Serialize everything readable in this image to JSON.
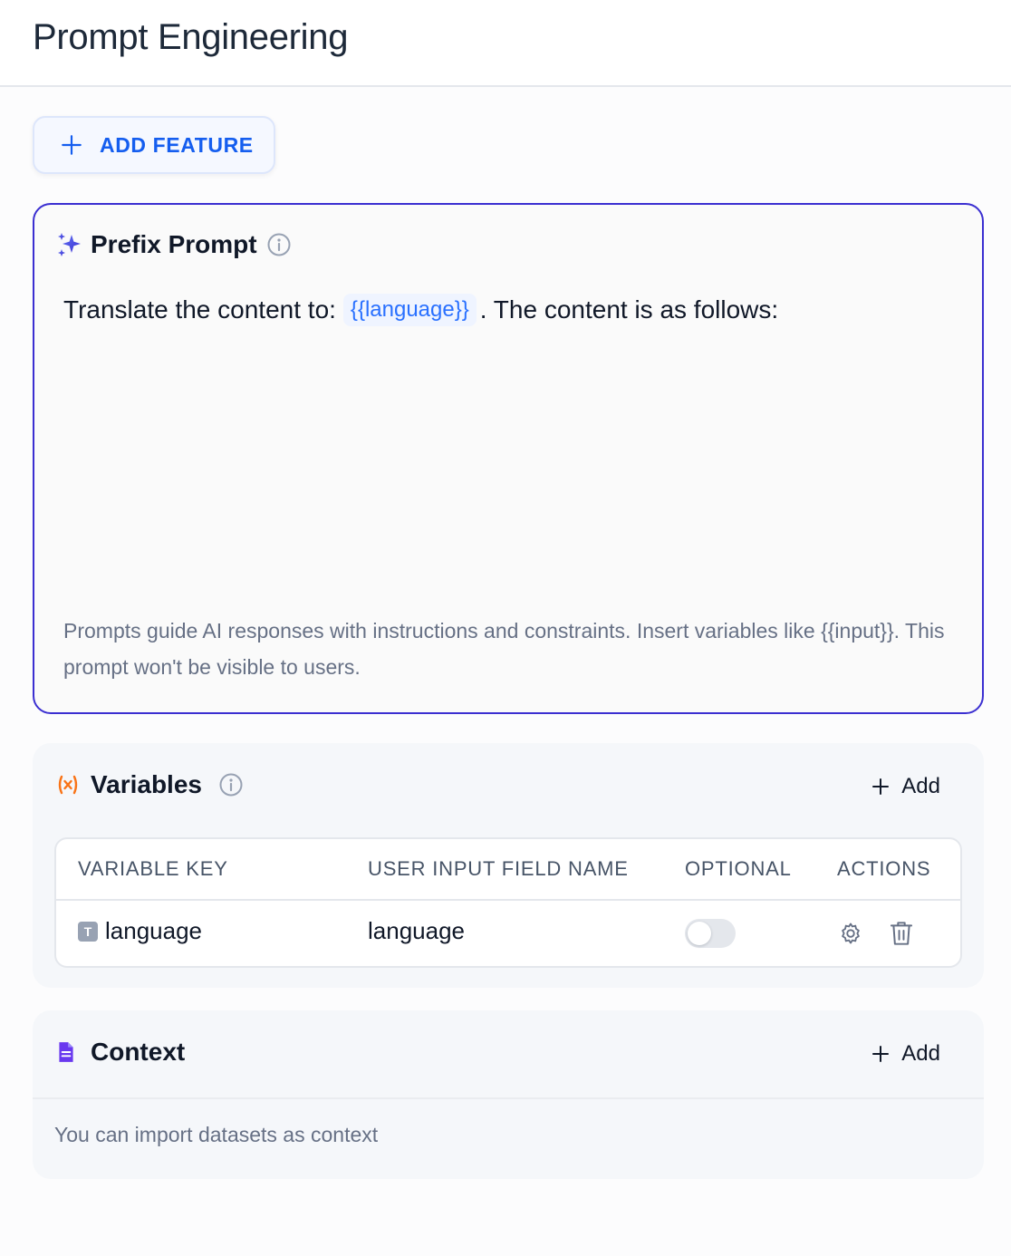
{
  "header": {
    "title": "Prompt Engineering"
  },
  "toolbar": {
    "add_feature_label": "ADD FEATURE"
  },
  "prefix_prompt": {
    "title": "Prefix Prompt",
    "text_before": "Translate the content to:",
    "variable": "{{language}}",
    "text_after": ". The content is as follows:",
    "hint": "Prompts guide AI responses with instructions and constraints. Insert variables like {{input}}. This prompt won't be visible to users."
  },
  "variables": {
    "title": "Variables",
    "add_label": "Add",
    "columns": [
      "VARIABLE KEY",
      "USER INPUT FIELD NAME",
      "OPTIONAL",
      "ACTIONS"
    ],
    "rows": [
      {
        "type_badge": "T",
        "key": "language",
        "field_name": "language",
        "optional": false
      }
    ]
  },
  "context": {
    "title": "Context",
    "add_label": "Add",
    "hint": "You can import datasets as context"
  },
  "colors": {
    "accent": "#155eef",
    "prompt_border": "#3b2fd1",
    "variable_icon": "#f97316",
    "context_icon": "#6938ef"
  },
  "icons": {
    "add_feature": "plus-icon",
    "prefix": "sparkle-icon",
    "info": "info-icon",
    "variables": "variable-x-icon",
    "context": "document-icon",
    "row_settings": "gear-icon",
    "row_delete": "trash-icon"
  }
}
